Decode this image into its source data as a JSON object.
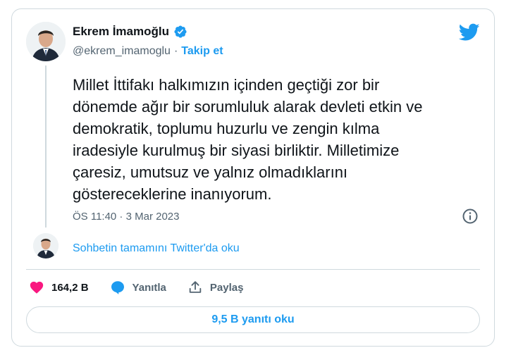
{
  "author": {
    "name": "Ekrem İmamoğlu",
    "handle": "@ekrem_imamoglu",
    "separator": "·",
    "follow_label": "Takip et",
    "verified_icon": "verified-badge-icon"
  },
  "tweet": {
    "text": "Millet İttifakı halkımızın içinden geçtiği zor bir\ndönemde ağır bir sorumluluk alarak devleti etkin ve\ndemokratik, toplumu huzurlu ve zengin kılma\niradesiyle kurulmuş bir siyasi birliktir. Milletimize\nçaresiz, umutsuz ve yalnız olmadıklarını\ngöstereceklerine inanıyorum.",
    "timestamp": "ÖS 11:40 · 3 Mar 2023"
  },
  "thread": {
    "read_more_label": "Sohbetin tamamını Twitter'da oku"
  },
  "actions": {
    "likes_count": "164,2 B",
    "reply_label": "Yanıtla",
    "share_label": "Paylaş"
  },
  "replies_button": {
    "label": "9,5 B yanıtı oku"
  },
  "colors": {
    "accent": "#1d9bf0",
    "like": "#f91880",
    "text": "#0f1419",
    "muted": "#536471",
    "border": "#cfd9de"
  }
}
